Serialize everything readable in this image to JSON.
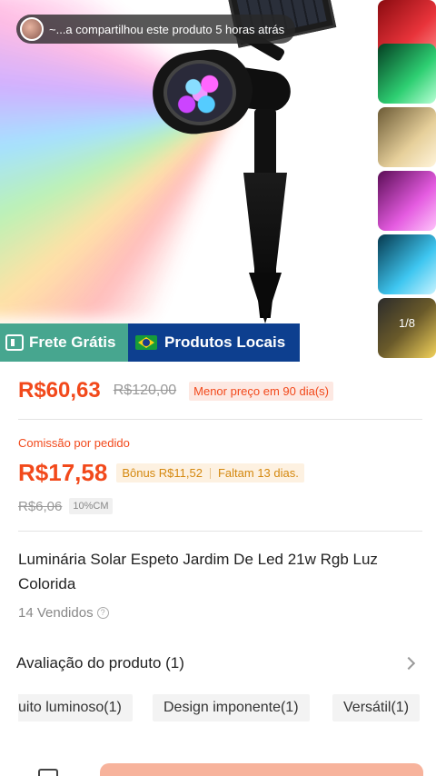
{
  "share": {
    "text": "~...a compartilhou este produto 5 horas atrás"
  },
  "gallery": {
    "counter": "1/8",
    "thumb_colors": [
      "#e8333a",
      "#2ecf72",
      "#e6cf9a",
      "#e45be0",
      "#3ec6f0",
      "#f2d25a"
    ]
  },
  "badges": {
    "frete": "Frete Grátis",
    "locais": "Produtos Locais"
  },
  "price": {
    "current": "R$60,63",
    "original": "R$120,00",
    "tag": "Menor preço em 90 dia(s)"
  },
  "commission": {
    "label": "Comissão por pedido",
    "value": "R$17,58",
    "bonus": "Bônus R$11,52",
    "remaining": "Faltam 13 dias.",
    "cm_value": "R$6,06",
    "cm_tag": "10%CM"
  },
  "product": {
    "title": "Luminária Solar Espeto Jardim De Led 21w Rgb Luz Colorida",
    "sold": "14 Vendidos"
  },
  "rating": {
    "title": "Avaliação do produto (1)",
    "chips": [
      "uito luminoso(1)",
      "Design imponente(1)",
      "Versátil(1)"
    ]
  },
  "colors": {
    "accent": "#f2491b",
    "frete_bg": "#47a68f",
    "locais_bg": "#0d3f8f",
    "cta": "#f7b39c"
  }
}
